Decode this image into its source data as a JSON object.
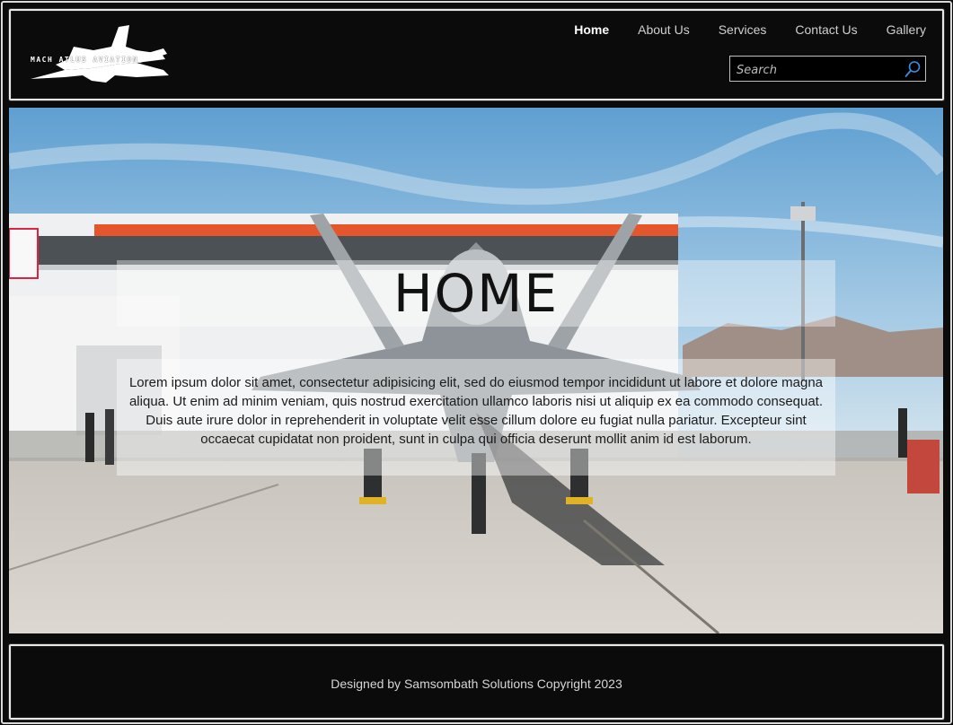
{
  "brand": {
    "logo_text": "MACH ATLUS AVIATION"
  },
  "nav": {
    "items": [
      {
        "label": "Home"
      },
      {
        "label": "About Us"
      },
      {
        "label": "Services"
      },
      {
        "label": "Contact Us"
      },
      {
        "label": "Gallery"
      }
    ]
  },
  "search": {
    "placeholder": "Search",
    "value": ""
  },
  "hero": {
    "title": "HOME",
    "body": "Lorem ipsum dolor sit amet, consectetur adipisicing elit, sed do eiusmod tempor incididunt ut labore et dolore magna aliqua. Ut enim ad minim veniam, quis nostrud exercitation ullamco laboris nisi ut aliquip ex ea commodo consequat. Duis aute irure dolor in reprehenderit in voluptate velit esse cillum dolore eu fugiat nulla pariatur. Excepteur sint occaecat cupidatat non proident, sunt in culpa qui officia deserunt mollit anim id est laborum."
  },
  "footer": {
    "text": "Designed by Samsombath Solutions Copyright 2023"
  },
  "colors": {
    "background": "#0b0b0b",
    "text_light": "#d0d0d0",
    "accent_search_icon": "#3a8fe0"
  },
  "icons": {
    "search": "search-icon",
    "logo": "jet-logo-icon"
  }
}
